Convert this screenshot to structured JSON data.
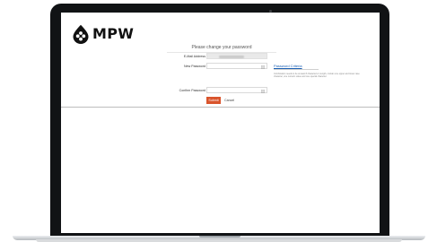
{
  "brand": {
    "name": "MPW",
    "logo_icon": "drop-logo-icon",
    "logo_color": "#111111"
  },
  "form": {
    "title": "Please change your password",
    "email_label": "E-Mail Address",
    "new_password_label": "New Password",
    "confirm_password_label": "Confirm Password",
    "new_password_value": "",
    "confirm_password_value": "",
    "show_password_icon": "eye-icon"
  },
  "password_help": {
    "link_label": "Password Criteria",
    "text": "Combination needs to be at least 8 characters in length, contain one upper and lower case character, one numeric value and one special character."
  },
  "buttons": {
    "submit_label": "Submit",
    "cancel_label": "Cancel"
  },
  "colors": {
    "submit_bg": "#d9542c",
    "link": "#1a5fb4",
    "laptop_bezel": "#111315"
  }
}
